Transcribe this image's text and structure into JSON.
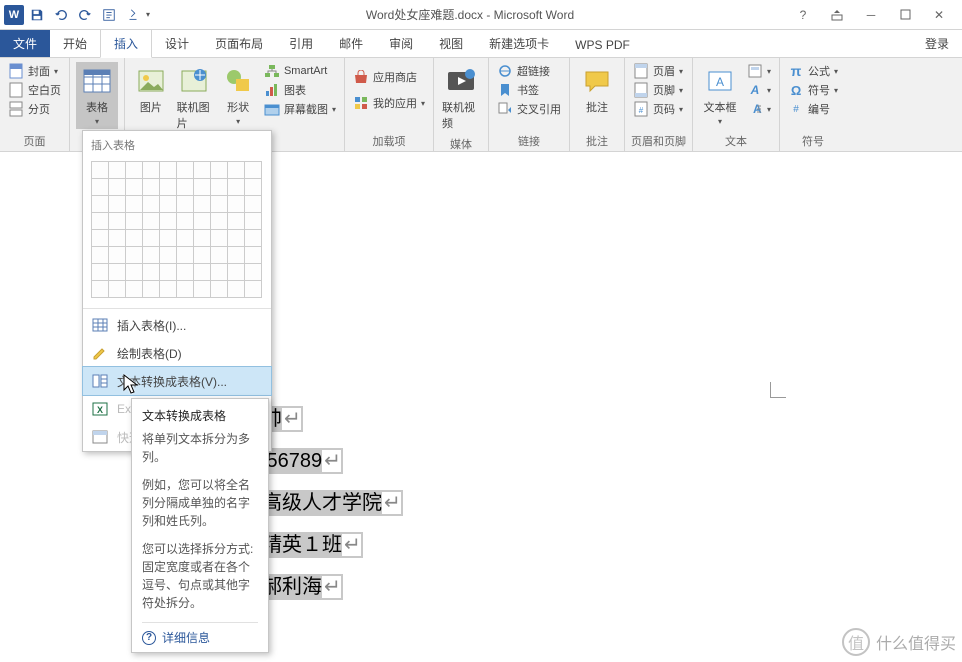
{
  "title": "Word处女座难题.docx - Microsoft Word",
  "tabs": {
    "file": "文件",
    "list": [
      "开始",
      "插入",
      "设计",
      "页面布局",
      "引用",
      "邮件",
      "审阅",
      "视图",
      "新建选项卡",
      "WPS PDF"
    ],
    "active_index": 1,
    "right": "登录"
  },
  "ribbon": {
    "pages": {
      "cover": "封面",
      "blank": "空白页",
      "break": "分页",
      "label": "页面"
    },
    "table": {
      "btn": "表格",
      "label": "表格"
    },
    "illus": {
      "pic": "图片",
      "online_pic": "联机图片",
      "shapes": "形状",
      "smartart": "SmartArt",
      "chart": "图表",
      "screenshot": "屏幕截图"
    },
    "addins": {
      "store": "应用商店",
      "myapps": "我的应用",
      "label": "加载项"
    },
    "media": {
      "online_video": "联机视频",
      "label": "媒体"
    },
    "links": {
      "hyperlink": "超链接",
      "bookmark": "书签",
      "crossref": "交叉引用",
      "label": "链接"
    },
    "comment": {
      "btn": "批注",
      "label": "批注"
    },
    "headerfooter": {
      "header": "页眉",
      "footer": "页脚",
      "pagenum": "页码",
      "label": "页眉和页脚"
    },
    "text": {
      "textbox": "文本框",
      "label": "文本"
    },
    "symbols": {
      "equation": "公式",
      "symbol": "符号",
      "numbering": "编号",
      "label": "符号"
    }
  },
  "dropdown": {
    "title": "插入表格",
    "insert_table": "插入表格(I)...",
    "draw_table": "绘制表格(D)",
    "convert_text": "文本转换成表格(V)...",
    "excel": "Exc",
    "quick": "快速"
  },
  "tooltip": {
    "title": "文本转换成表格",
    "p1": "将单列文本拆分为多列。",
    "p2": "例如，您可以将全名列分隔成单独的名字列和姓氏列。",
    "p3": "您可以选择拆分方式: 固定宽度或者在各个逗号、句点或其他字符处拆分。",
    "more": "详细信息"
  },
  "document": {
    "lines": [
      {
        "pre": "",
        "txt": "李大帅"
      },
      {
        "pre": "",
        "txt": "123456789"
      },
      {
        "pre": "",
        "txt": "院：高级人才学院"
      },
      {
        "pre": "",
        "txt": "业：精英１班"
      },
      {
        "pre": "",
        "txt": "师：郝利海"
      }
    ]
  },
  "watermark": "什么值得买"
}
